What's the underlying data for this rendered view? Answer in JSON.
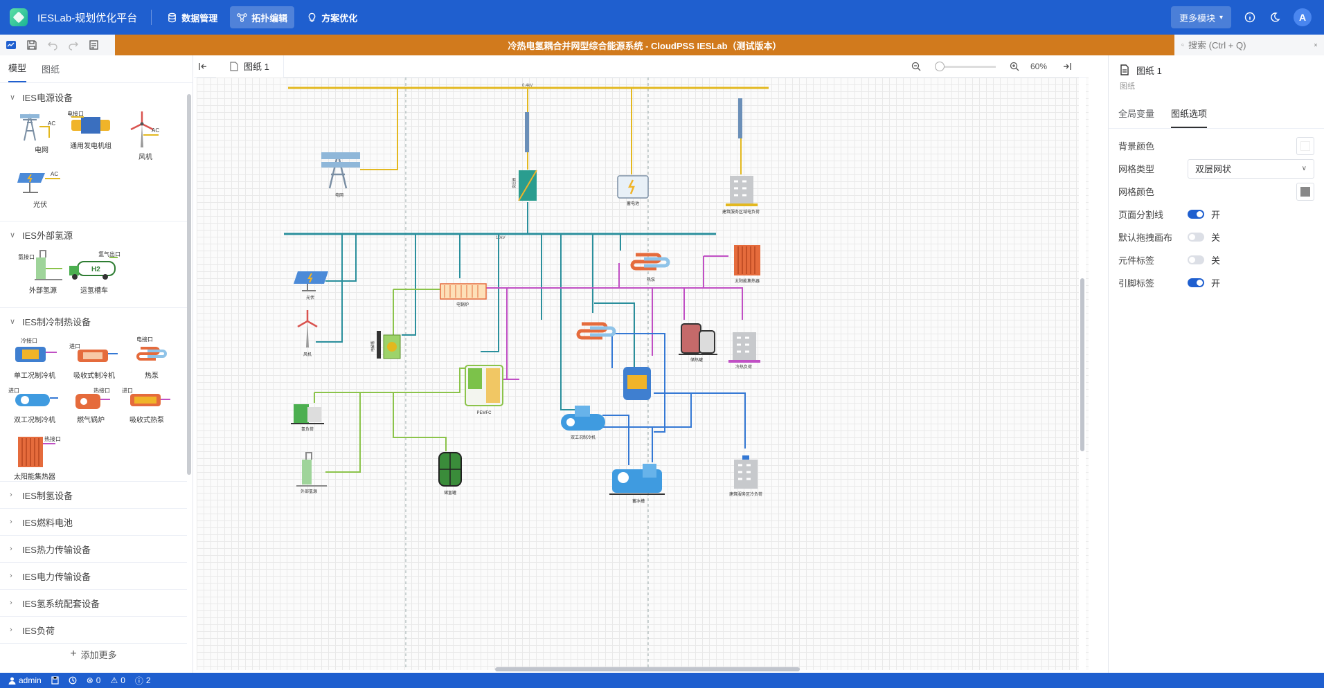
{
  "app": {
    "title": "IESLab-规划优化平台"
  },
  "nav": [
    {
      "label": "数据管理",
      "icon": "database-icon",
      "active": false
    },
    {
      "label": "拓扑编辑",
      "icon": "topology-icon",
      "active": true
    },
    {
      "label": "方案优化",
      "icon": "bulb-icon",
      "active": false
    }
  ],
  "header_right": {
    "more_modules": "更多模块",
    "avatar": "A"
  },
  "document": {
    "title": "冷热电氢耦合并网型综合能源系统 - CloudPSS IESLab（测试版本）"
  },
  "search": {
    "placeholder": "搜索 (Ctrl + Q)"
  },
  "left_panel": {
    "tabs": [
      "模型",
      "图纸"
    ],
    "groups": [
      {
        "title": "IES电源设备",
        "expanded": true,
        "items": [
          {
            "label": "电网",
            "tag": "AC"
          },
          {
            "label": "通用发电机组",
            "tag": "电接口"
          },
          {
            "label": "风机",
            "tag": "AC"
          },
          {
            "label": "光伏",
            "tag": "AC"
          }
        ]
      },
      {
        "title": "IES外部氢源",
        "expanded": true,
        "items": [
          {
            "label": "外部氢源",
            "tag": "氢接口"
          },
          {
            "label": "运氢槽车",
            "tag": "氢气出口"
          }
        ]
      },
      {
        "title": "IES制冷制热设备",
        "expanded": true,
        "items": [
          {
            "label": "单工况制冷机",
            "tag": "冷接口"
          },
          {
            "label": "吸收式制冷机",
            "tag": "进口"
          },
          {
            "label": "热泵",
            "tag": "电接口"
          },
          {
            "label": "双工况制冷机",
            "tag": "进口"
          },
          {
            "label": "燃气锅炉",
            "tag": "热接口"
          },
          {
            "label": "吸收式热泵",
            "tag": "进口"
          },
          {
            "label": "太阳能集热器",
            "tag": "热接口"
          }
        ]
      },
      {
        "title": "IES制氢设备",
        "expanded": false
      },
      {
        "title": "IES燃料电池",
        "expanded": false
      },
      {
        "title": "IES热力传输设备",
        "expanded": false
      },
      {
        "title": "IES电力传输设备",
        "expanded": false
      },
      {
        "title": "IES氢系统配套设备",
        "expanded": false
      },
      {
        "title": "IES负荷",
        "expanded": false
      }
    ],
    "add_more": "添加更多"
  },
  "canvas": {
    "tab": "图纸 1",
    "zoom": "60%",
    "bus_labels": [
      "0.4kV",
      "10kV"
    ],
    "devices": [
      {
        "label": "电网"
      },
      {
        "label": "变压器"
      },
      {
        "label": "蓄电池"
      },
      {
        "label": "建筑服务区域电负荷"
      },
      {
        "label": "光伏"
      },
      {
        "label": "电锅炉"
      },
      {
        "label": "热泵"
      },
      {
        "label": "太阳能集热器"
      },
      {
        "label": "风机"
      },
      {
        "label": "电解槽"
      },
      {
        "label": "储热罐"
      },
      {
        "label": "冷热负荷"
      },
      {
        "label": "PEMFC"
      },
      {
        "label": "双工况制冷机"
      },
      {
        "label": "氢负荷"
      },
      {
        "label": "储氢罐"
      },
      {
        "label": "外部氢源"
      },
      {
        "label": "蓄冰槽"
      },
      {
        "label": "建筑服务区冷负荷"
      }
    ]
  },
  "right_panel": {
    "title": "图纸 1",
    "subtitle": "图纸",
    "tabs": [
      "全局变量",
      "图纸选项"
    ],
    "active_tab": "图纸选项",
    "props": [
      {
        "label": "背景颜色",
        "type": "color",
        "value": "#ffffff"
      },
      {
        "label": "网格类型",
        "type": "select",
        "value": "双层网状"
      },
      {
        "label": "网格颜色",
        "type": "color",
        "value": "#888888"
      },
      {
        "label": "页面分割线",
        "type": "switch",
        "on": true,
        "text": "开"
      },
      {
        "label": "默认拖拽画布",
        "type": "switch",
        "on": false,
        "text": "关"
      },
      {
        "label": "元件标签",
        "type": "switch",
        "on": false,
        "text": "关"
      },
      {
        "label": "引脚标签",
        "type": "switch",
        "on": true,
        "text": "开"
      }
    ]
  },
  "status": {
    "user": "admin",
    "errors": "0",
    "warnings": "0",
    "infos": "2"
  },
  "colors": {
    "primary": "#1f5fcf",
    "doc_bar": "#d17a1d",
    "bus_yellow": "#e3b81f",
    "bus_teal": "#2a8f9c",
    "heat_pink": "#c04fc4",
    "cold_blue": "#3478d4",
    "h2_green": "#8bc34a"
  }
}
